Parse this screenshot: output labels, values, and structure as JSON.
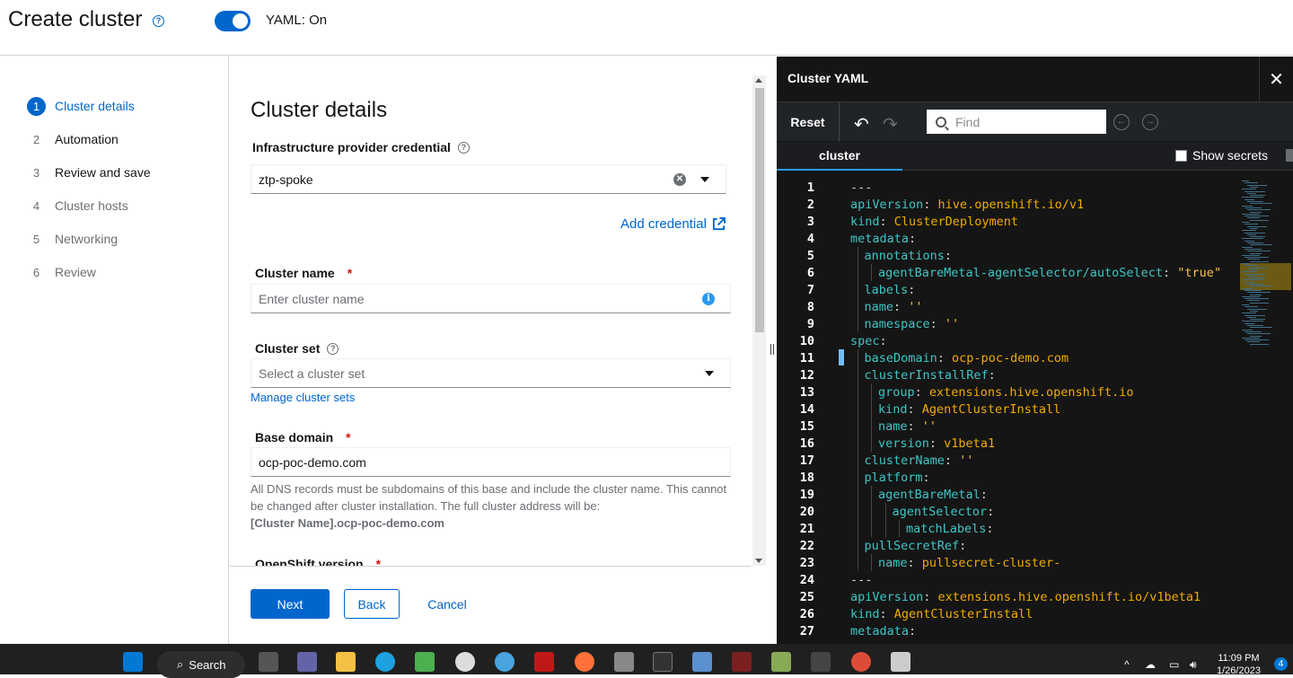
{
  "header": {
    "title": "Create cluster",
    "help_icon": "?",
    "yaml_toggle_label": "YAML: On"
  },
  "wizard": {
    "steps": [
      {
        "num": "1",
        "label": "Cluster details",
        "state": "active"
      },
      {
        "num": "2",
        "label": "Automation",
        "state": "normal"
      },
      {
        "num": "3",
        "label": "Review and save",
        "state": "normal"
      },
      {
        "num": "4",
        "label": "Cluster hosts",
        "state": "disabled"
      },
      {
        "num": "5",
        "label": "Networking",
        "state": "disabled"
      },
      {
        "num": "6",
        "label": "Review",
        "state": "disabled"
      }
    ],
    "section_title": "Cluster details",
    "credential": {
      "label": "Infrastructure provider credential",
      "value": "ztp-spoke",
      "add_link": "Add credential"
    },
    "cluster_name": {
      "label": "Cluster name",
      "required": "*",
      "placeholder": "Enter cluster name"
    },
    "cluster_set": {
      "label": "Cluster set",
      "placeholder": "Select a cluster set",
      "manage_link": "Manage cluster sets"
    },
    "base_domain": {
      "label": "Base domain",
      "required": "*",
      "value": "ocp-poc-demo.com",
      "helper": "All DNS records must be subdomains of this base and include the cluster name. This cannot be changed after cluster installation. The full cluster address will be:",
      "helper_address": "[Cluster Name].ocp-poc-demo.com"
    },
    "openshift_version": {
      "label": "OpenShift version",
      "required": "*"
    },
    "footer": {
      "next": "Next",
      "back": "Back",
      "cancel": "Cancel"
    }
  },
  "yaml_panel": {
    "title": "Cluster YAML",
    "close": "✕",
    "reset": "Reset",
    "undo_icon": "↶",
    "redo_icon": "↷",
    "find_placeholder": "Find",
    "prev_icon": "←",
    "next_icon": "→",
    "tab": "cluster",
    "show_secrets": "Show secrets",
    "lines": [
      {
        "n": "1",
        "indent": 0,
        "k": "---",
        "v": "",
        "t": "plain"
      },
      {
        "n": "2",
        "indent": 0,
        "k": "apiVersion",
        "v": "hive.openshift.io/v1",
        "t": "val"
      },
      {
        "n": "3",
        "indent": 0,
        "k": "kind",
        "v": "ClusterDeployment",
        "t": "val"
      },
      {
        "n": "4",
        "indent": 0,
        "k": "metadata",
        "v": "",
        "t": "none"
      },
      {
        "n": "5",
        "indent": 1,
        "k": "annotations",
        "v": "",
        "t": "none"
      },
      {
        "n": "6",
        "indent": 2,
        "k": "agentBareMetal-agentSelector/autoSelect",
        "v": "\"true\"",
        "t": "str"
      },
      {
        "n": "7",
        "indent": 1,
        "k": "labels",
        "v": "",
        "t": "none"
      },
      {
        "n": "8",
        "indent": 1,
        "k": "name",
        "v": "''",
        "t": "str"
      },
      {
        "n": "9",
        "indent": 1,
        "k": "namespace",
        "v": "''",
        "t": "str"
      },
      {
        "n": "10",
        "indent": 0,
        "k": "spec",
        "v": "",
        "t": "none"
      },
      {
        "n": "11",
        "indent": 1,
        "k": "baseDomain",
        "v": "ocp-poc-demo.com",
        "t": "val"
      },
      {
        "n": "12",
        "indent": 1,
        "k": "clusterInstallRef",
        "v": "",
        "t": "none"
      },
      {
        "n": "13",
        "indent": 2,
        "k": "group",
        "v": "extensions.hive.openshift.io",
        "t": "val"
      },
      {
        "n": "14",
        "indent": 2,
        "k": "kind",
        "v": "AgentClusterInstall",
        "t": "val"
      },
      {
        "n": "15",
        "indent": 2,
        "k": "name",
        "v": "''",
        "t": "str"
      },
      {
        "n": "16",
        "indent": 2,
        "k": "version",
        "v": "v1beta1",
        "t": "val"
      },
      {
        "n": "17",
        "indent": 1,
        "k": "clusterName",
        "v": "''",
        "t": "str"
      },
      {
        "n": "18",
        "indent": 1,
        "k": "platform",
        "v": "",
        "t": "none"
      },
      {
        "n": "19",
        "indent": 2,
        "k": "agentBareMetal",
        "v": "",
        "t": "none"
      },
      {
        "n": "20",
        "indent": 3,
        "k": "agentSelector",
        "v": "",
        "t": "none"
      },
      {
        "n": "21",
        "indent": 4,
        "k": "matchLabels",
        "v": "",
        "t": "none"
      },
      {
        "n": "22",
        "indent": 1,
        "k": "pullSecretRef",
        "v": "",
        "t": "none"
      },
      {
        "n": "23",
        "indent": 2,
        "k": "name",
        "v": "pullsecret-cluster-",
        "t": "val"
      },
      {
        "n": "24",
        "indent": 0,
        "k": "---",
        "v": "",
        "t": "plain"
      },
      {
        "n": "25",
        "indent": 0,
        "k": "apiVersion",
        "v": "extensions.hive.openshift.io/v1beta1",
        "t": "val"
      },
      {
        "n": "26",
        "indent": 0,
        "k": "kind",
        "v": "AgentClusterInstall",
        "t": "val"
      },
      {
        "n": "27",
        "indent": 0,
        "k": "metadata",
        "v": "",
        "t": "none"
      }
    ]
  },
  "taskbar": {
    "search_label": "Search",
    "time": "11:09 PM",
    "date": "1/26/2023",
    "notification_count": "4",
    "colors": {
      "background": "#202020",
      "accent": "#0078d4"
    }
  },
  "colors": {
    "primary": "#0066cc",
    "required": "#c9190b",
    "editor_bg": "#151515",
    "yaml_key": "#3ec6c6",
    "yaml_value": "#f0ab00"
  }
}
